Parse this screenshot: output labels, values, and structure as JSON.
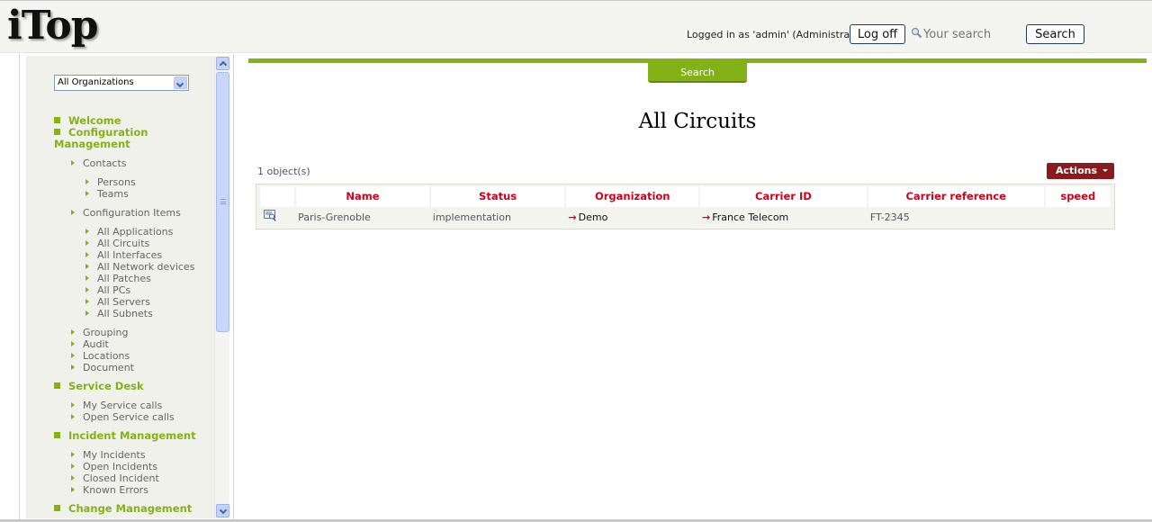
{
  "header": {
    "logo": "iTop",
    "logged_in_text": "Logged in as 'admin' (Administrator)",
    "logoff_label": "Log off",
    "search_placeholder": "Your search",
    "search_label": "Search"
  },
  "sidebar": {
    "organization_select": "All Organizations",
    "sections": [
      {
        "label": "Welcome"
      },
      {
        "label": "Configuration Management"
      },
      {
        "label": "Service Desk"
      },
      {
        "label": "Incident Management"
      },
      {
        "label": "Change Management"
      }
    ],
    "contacts": {
      "label": "Contacts",
      "items": [
        "Persons",
        "Teams"
      ]
    },
    "config_items": {
      "label": "Configuration Items",
      "items": [
        "All Applications",
        "All Circuits",
        "All Interfaces",
        "All Network devices",
        "All Patches",
        "All PCs",
        "All Servers",
        "All Subnets"
      ]
    },
    "config_misc": [
      "Grouping",
      "Audit",
      "Locations",
      "Document"
    ],
    "service_desk_items": [
      "My Service calls",
      "Open Service calls"
    ],
    "incident_items": [
      "My Incidents",
      "Open Incidents",
      "Closed Incident",
      "Known Errors"
    ]
  },
  "main": {
    "search_tab": "Search",
    "title": "All Circuits",
    "object_count": "1 object(s)",
    "actions_label": "Actions",
    "table": {
      "headers": [
        "Name",
        "Status",
        "Organization",
        "Carrier ID",
        "Carrier reference",
        "speed"
      ],
      "rows": [
        {
          "name": "Paris-Grenoble",
          "status": "implementation",
          "organization": "Demo",
          "carrier_id": "France Telecom",
          "carrier_reference": "FT-2345",
          "speed": ""
        }
      ]
    }
  },
  "colors": {
    "accent_green": "#83b217",
    "header_red": "#d0021b",
    "actions_red": "#891a1e",
    "sidebar_bg": "#f1f1ec"
  }
}
